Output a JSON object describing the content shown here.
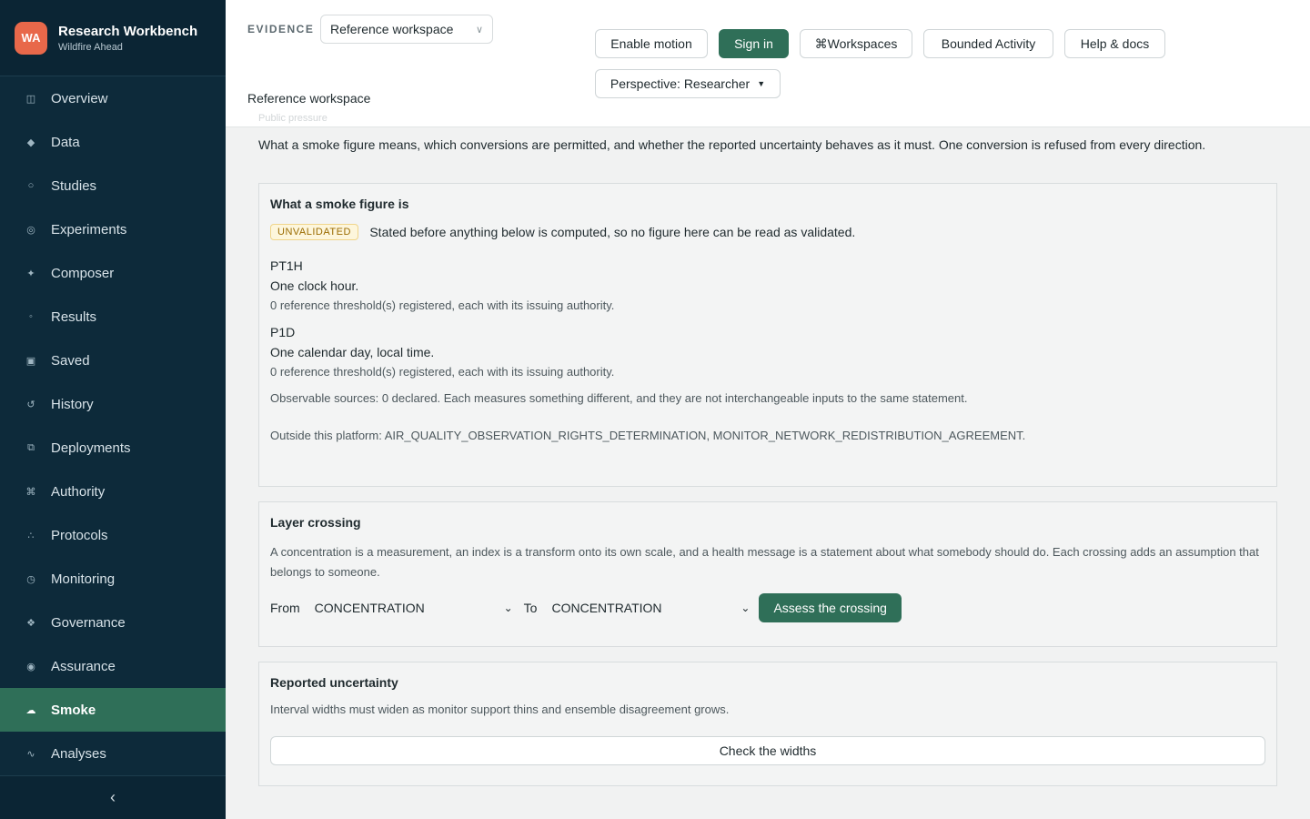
{
  "brand": {
    "initials": "WA",
    "title": "Research Workbench",
    "subtitle": "Wildfire Ahead",
    "badge_color": "#e8684a"
  },
  "sidebar": {
    "items": [
      {
        "label": "Overview",
        "icon": "grid-icon",
        "glyph": "◫"
      },
      {
        "label": "Data",
        "icon": "diamond-icon",
        "glyph": "◆"
      },
      {
        "label": "Studies",
        "icon": "circle-icon",
        "glyph": "○"
      },
      {
        "label": "Experiments",
        "icon": "target-icon",
        "glyph": "◎"
      },
      {
        "label": "Composer",
        "icon": "sparkle-icon",
        "glyph": "✦"
      },
      {
        "label": "Results",
        "icon": "small-circle-icon",
        "glyph": "◦"
      },
      {
        "label": "Saved",
        "icon": "bookmark-icon",
        "glyph": "▣"
      },
      {
        "label": "History",
        "icon": "history-icon",
        "glyph": "↺"
      },
      {
        "label": "Deployments",
        "icon": "deploy-icon",
        "glyph": "⧉"
      },
      {
        "label": "Authority",
        "icon": "authority-icon",
        "glyph": "⌘"
      },
      {
        "label": "Protocols",
        "icon": "protocols-icon",
        "glyph": "∴"
      },
      {
        "label": "Monitoring",
        "icon": "monitor-icon",
        "glyph": "◷"
      },
      {
        "label": "Governance",
        "icon": "governance-icon",
        "glyph": "❖"
      },
      {
        "label": "Assurance",
        "icon": "assurance-icon",
        "glyph": "◉"
      },
      {
        "label": "Smoke",
        "icon": "cloud-icon",
        "glyph": "☁",
        "active": true
      },
      {
        "label": "Analyses",
        "icon": "wave-icon",
        "glyph": "∿"
      }
    ],
    "collapse_glyph": "‹",
    "active_color": "#2f6f58",
    "background": "#0d2a3a"
  },
  "header": {
    "evidence_label": "EVIDENCE",
    "workspace_value": "Reference workspace",
    "workspace_caption": "Reference workspace",
    "ghost_text": "Public pressure",
    "buttons": {
      "enable_motion": "Enable motion",
      "sign_in": "Sign in",
      "workspaces": "⌘Workspaces",
      "bounded_activity": "Bounded Activity",
      "help": "Help & docs",
      "perspective": "Perspective: Researcher"
    }
  },
  "main": {
    "intro": "What a smoke figure means, which conversions are permitted, and whether the reported uncertainty behaves as it must. One conversion is refused from every direction.",
    "figure_card": {
      "title": "What a smoke figure is",
      "badge": "UNVALIDATED",
      "badge_text": "Stated before anything below is computed, so no figure here can be read as validated.",
      "definitions": [
        {
          "code": "PT1H",
          "title": "One clock hour.",
          "note": "0 reference threshold(s) registered, each with its issuing authority."
        },
        {
          "code": "P1D",
          "title": "One calendar day, local time.",
          "note": "0 reference threshold(s) registered, each with its issuing authority."
        }
      ],
      "observable": "Observable sources: 0 declared. Each measures something different, and they are not interchangeable inputs to the same statement.",
      "outside": "Outside this platform: AIR_QUALITY_OBSERVATION_RIGHTS_DETERMINATION, MONITOR_NETWORK_REDISTRIBUTION_AGREEMENT."
    },
    "layer_card": {
      "title": "Layer crossing",
      "description": "A concentration is a measurement, an index is a transform onto its own scale, and a health message is a statement about what somebody should do. Each crossing adds an assumption that belongs to someone.",
      "from_label": "From",
      "from_value": "CONCENTRATION",
      "to_label": "To",
      "to_value": "CONCENTRATION",
      "assess_button": "Assess the crossing"
    },
    "uncertainty_card": {
      "title": "Reported uncertainty",
      "description": "Interval widths must widen as monitor support thins and ensemble disagreement grows.",
      "check_button": "Check the widths"
    }
  }
}
